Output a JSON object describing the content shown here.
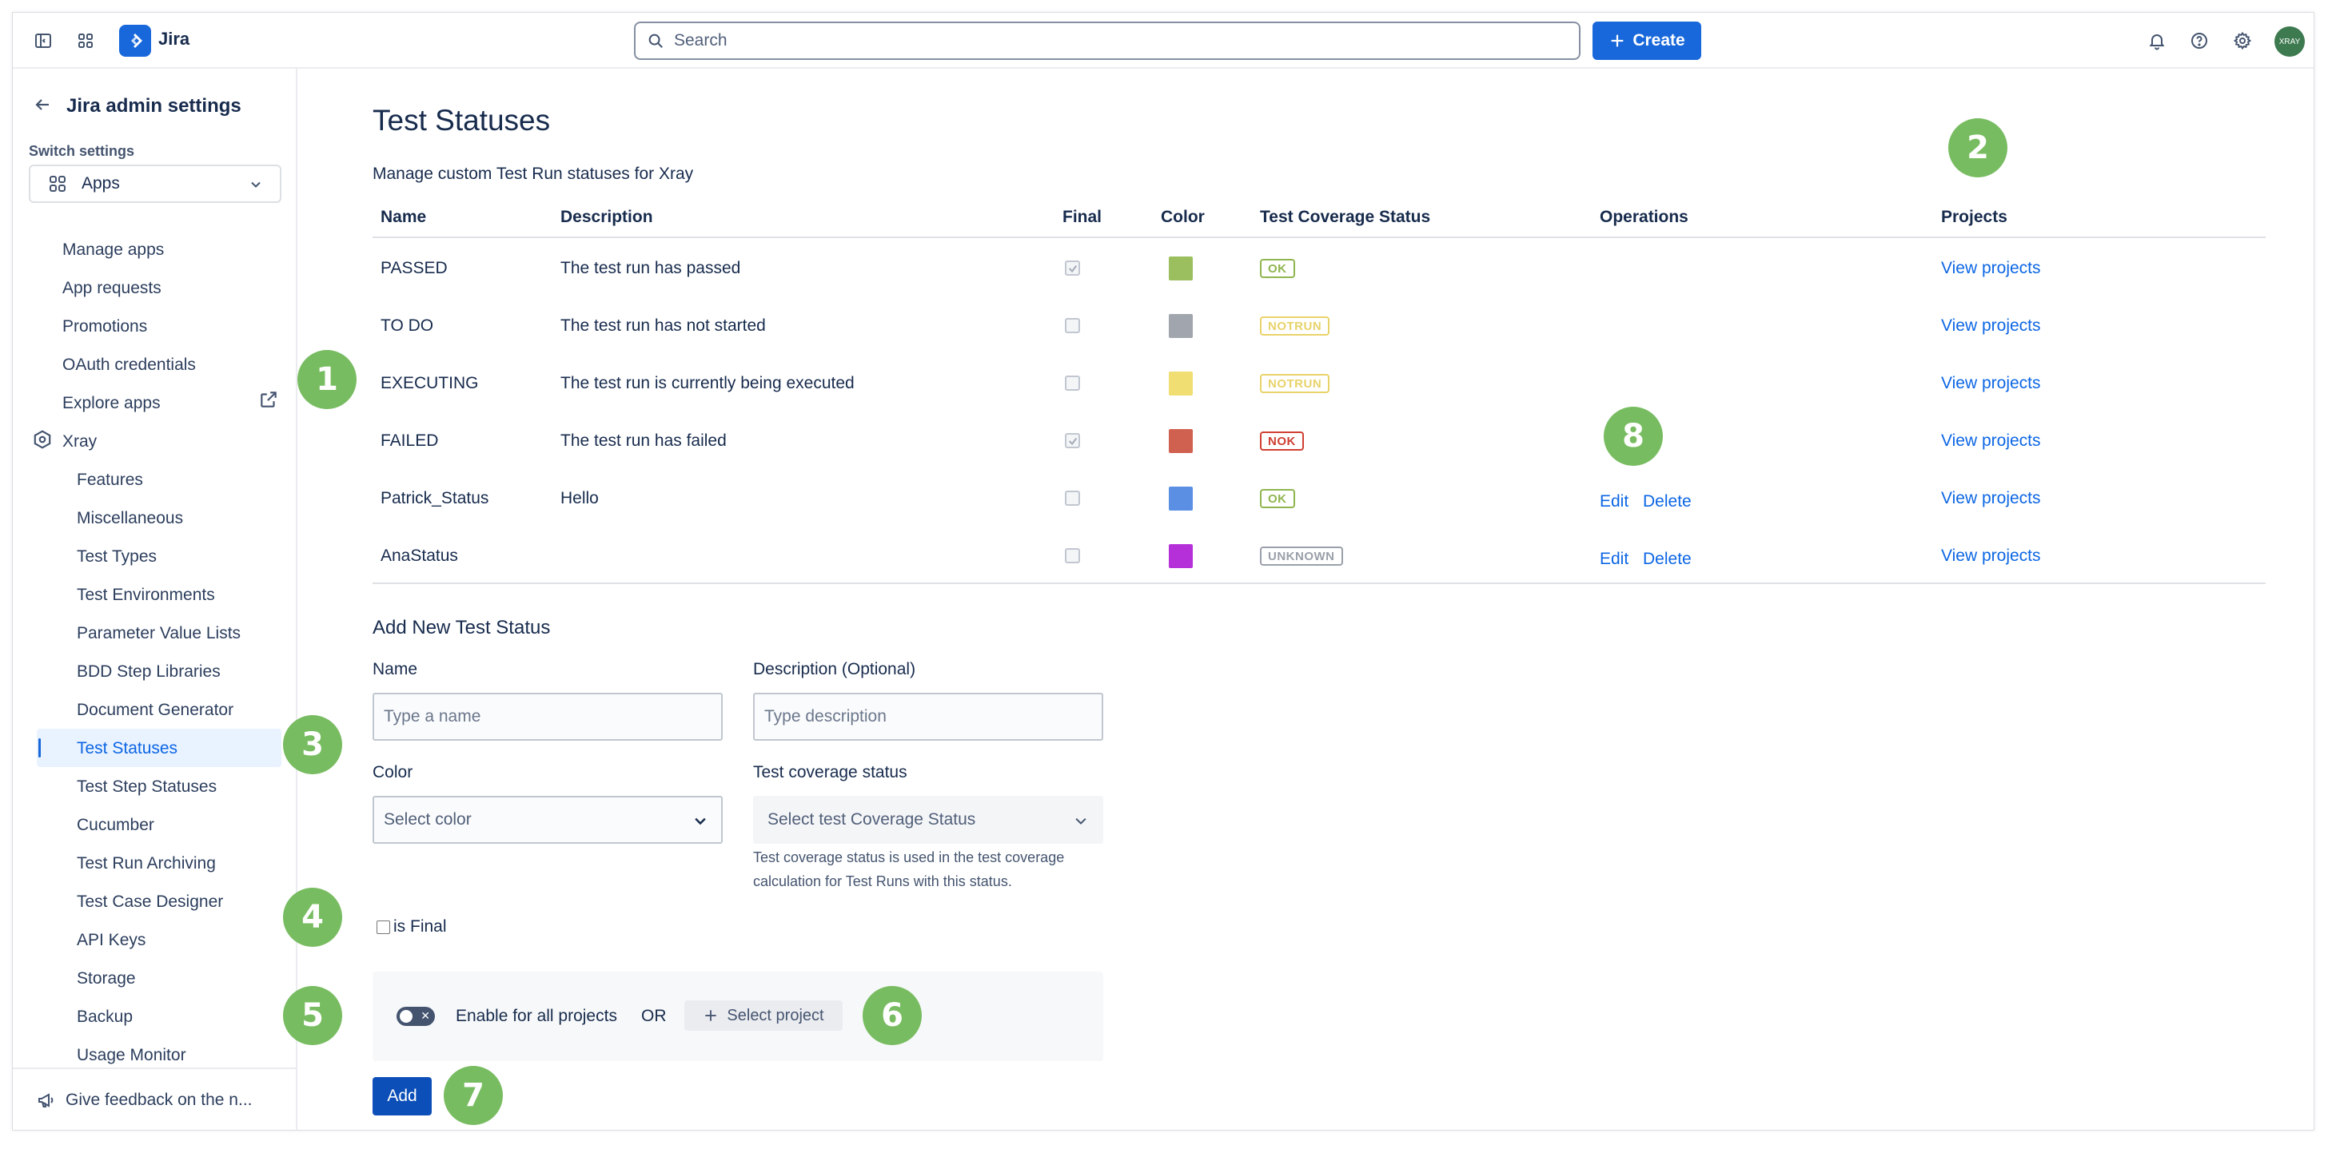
{
  "topbar": {
    "app_name": "Jira",
    "search_placeholder": "Search",
    "create_label": "Create",
    "avatar_initials": "XRAY"
  },
  "sidebar": {
    "title": "Jira admin settings",
    "switch_label": "Switch settings",
    "switch_value": "Apps",
    "apps_items": [
      {
        "label": "Manage apps"
      },
      {
        "label": "App requests"
      },
      {
        "label": "Promotions"
      },
      {
        "label": "OAuth credentials"
      },
      {
        "label": "Explore apps"
      }
    ],
    "xray_label": "Xray",
    "xray_items": [
      {
        "label": "Features"
      },
      {
        "label": "Miscellaneous"
      },
      {
        "label": "Test Types"
      },
      {
        "label": "Test Environments"
      },
      {
        "label": "Parameter Value Lists"
      },
      {
        "label": "BDD Step Libraries"
      },
      {
        "label": "Document Generator"
      },
      {
        "label": "Test Statuses"
      },
      {
        "label": "Test Step Statuses"
      },
      {
        "label": "Cucumber"
      },
      {
        "label": "Test Run Archiving"
      },
      {
        "label": "Test Case Designer"
      },
      {
        "label": "API Keys"
      },
      {
        "label": "Storage"
      },
      {
        "label": "Backup"
      },
      {
        "label": "Usage Monitor"
      }
    ],
    "active_item": "Test Statuses",
    "feedback_label": "Give feedback on the n..."
  },
  "main": {
    "title": "Test Statuses",
    "subtitle": "Manage custom Test Run statuses for Xray",
    "columns": {
      "name": "Name",
      "description": "Description",
      "final": "Final",
      "color": "Color",
      "coverage": "Test Coverage Status",
      "operations": "Operations",
      "projects": "Projects"
    },
    "rows": [
      {
        "name": "PASSED",
        "description": "The test run has passed",
        "final": true,
        "color": "#9bbf5f",
        "coverage": "OK",
        "coverage_color": "#8fb54f",
        "edit": "",
        "delete": "",
        "projects": "View projects"
      },
      {
        "name": "TO DO",
        "description": "The test run has not started",
        "final": false,
        "color": "#a1a5ad",
        "coverage": "NOTRUN",
        "coverage_color": "#e8d36a",
        "edit": "",
        "delete": "",
        "projects": "View projects"
      },
      {
        "name": "EXECUTING",
        "description": "The test run is currently being executed",
        "final": false,
        "color": "#f0de73",
        "coverage": "NOTRUN",
        "coverage_color": "#e8d36a",
        "edit": "",
        "delete": "",
        "projects": "View projects"
      },
      {
        "name": "FAILED",
        "description": "The test run has failed",
        "final": true,
        "color": "#d0604f",
        "coverage": "NOK",
        "coverage_color": "#cf3f31",
        "edit": "",
        "delete": "",
        "projects": "View projects"
      },
      {
        "name": "Patrick_Status",
        "description": "Hello",
        "final": false,
        "color": "#5a8fe4",
        "coverage": "OK",
        "coverage_color": "#8fb54f",
        "edit": "Edit",
        "delete": "Delete",
        "projects": "View projects"
      },
      {
        "name": "AnaStatus",
        "description": "",
        "final": false,
        "color": "#b630d9",
        "coverage": "UNKNOWN",
        "coverage_color": "#9aa0aa",
        "edit": "Edit",
        "delete": "Delete",
        "projects": "View projects"
      }
    ],
    "form": {
      "section_title": "Add New Test Status",
      "name_label": "Name",
      "name_placeholder": "Type a name",
      "description_label": "Description (Optional)",
      "description_placeholder": "Type description",
      "color_label": "Color",
      "color_placeholder": "Select color",
      "coverage_label": "Test coverage status",
      "coverage_placeholder": "Select test Coverage Status",
      "coverage_help": "Test coverage status is used in the test coverage calculation for Test Runs with this status.",
      "is_final_label": "is Final",
      "enable_all_label": "Enable for all projects",
      "or_label": "OR",
      "select_project_label": "Select project",
      "add_label": "Add"
    }
  },
  "markers": [
    "1",
    "2",
    "3",
    "4",
    "5",
    "6",
    "7",
    "8"
  ],
  "colors": {
    "accent": "#1868db",
    "link": "#0c66e4",
    "marker": "#78bc61",
    "add_button": "#0c4fb8"
  }
}
